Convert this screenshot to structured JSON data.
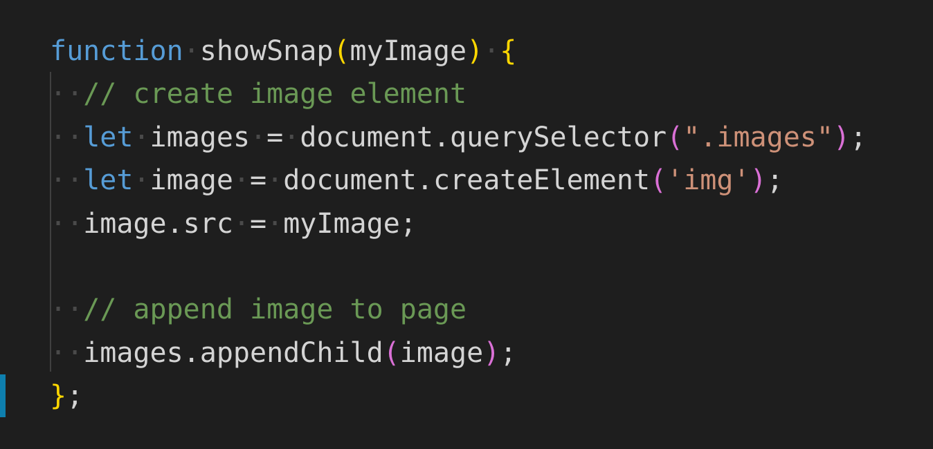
{
  "code": {
    "lines": [
      {
        "kw": "function",
        "name": "showSnap",
        "open": "(",
        "param": "myImage",
        "close": ")",
        "brace": "{"
      },
      {
        "comment": "// create image element"
      },
      {
        "kw": "let",
        "var": "images",
        "eq": "=",
        "call": "document.querySelector",
        "open": "(",
        "str": "\".images\"",
        "close": ")",
        "semi": ";"
      },
      {
        "kw": "let",
        "var": "image",
        "eq": "=",
        "call": "document.createElement",
        "open": "(",
        "str": "'img'",
        "close": ")",
        "semi": ";"
      },
      {
        "expr": "image.src",
        "eq": "=",
        "value": "myImage;"
      },
      {},
      {
        "comment": "// append image to page"
      },
      {
        "call": "images.appendChild",
        "open": "(",
        "arg": "image",
        "close": ")",
        "semi": ";"
      },
      {
        "brace": "}",
        "semi": ";"
      }
    ]
  },
  "whitespace_dot": "·",
  "colors": {
    "background": "#1e1e1e",
    "keyword": "#569cd6",
    "comment": "#6a9955",
    "string": "#ce9178",
    "bracket_level1": "#ffd700",
    "bracket_level2": "#da70d6",
    "default_text": "#d4d4d4",
    "cursor_marker": "#0e7fae"
  }
}
